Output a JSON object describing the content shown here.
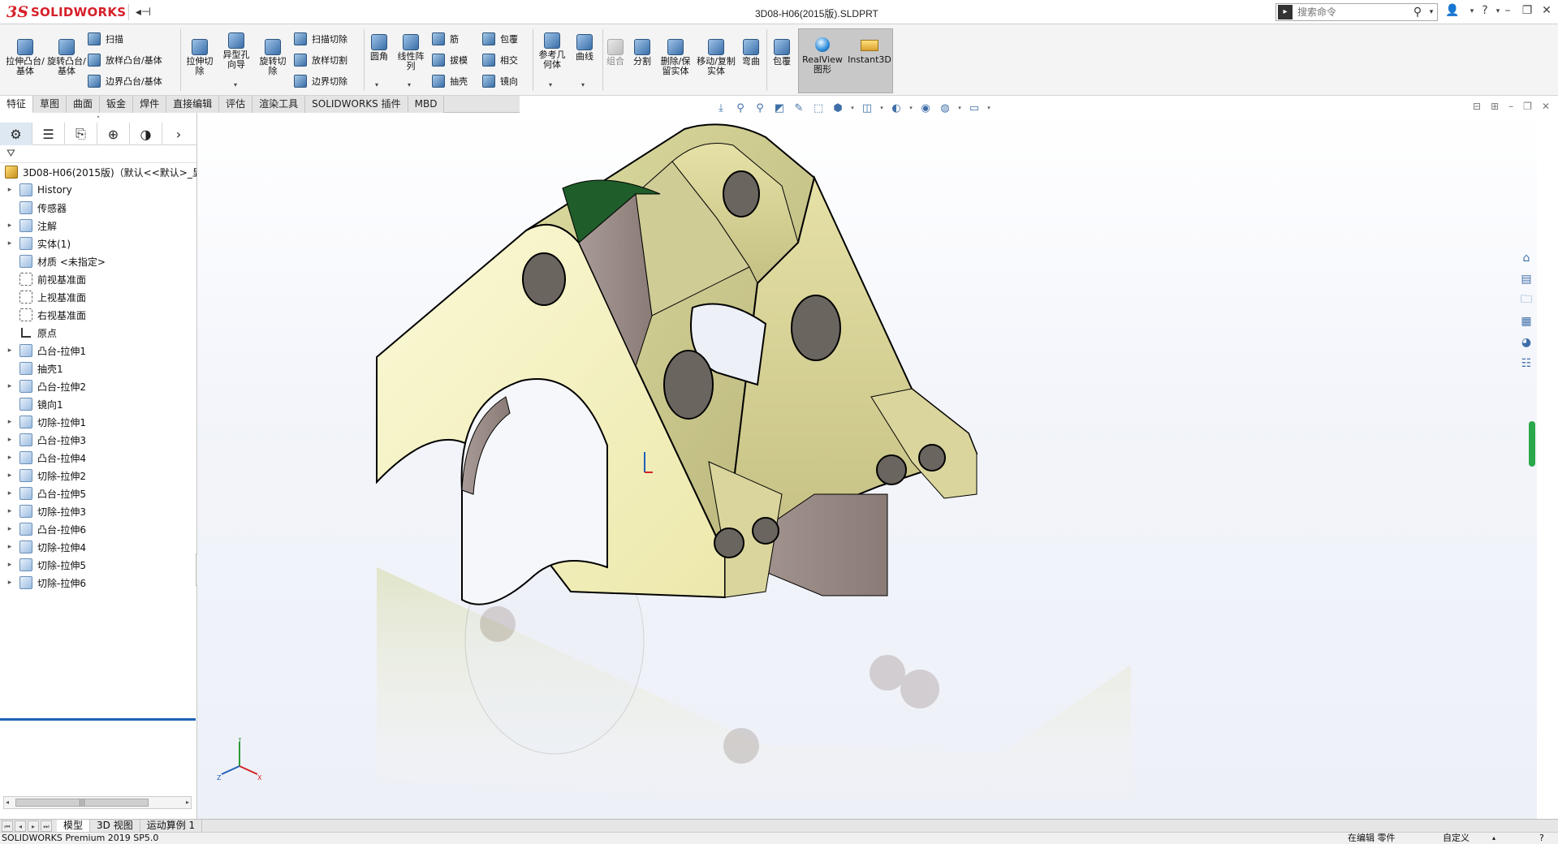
{
  "window": {
    "title": "3D08-H06(2015版).SLDPRT",
    "logo_ds": "3S",
    "logo_text": "SOLIDWORKS",
    "search": {
      "placeholder": "搜索命令"
    }
  },
  "ribbon": {
    "extrude_boss": "拉伸凸台/基体",
    "revolve_boss": "旋转凸台/基体",
    "sweep": "扫描",
    "loft_boss": "放样凸台/基体",
    "boundary_boss": "边界凸台/基体",
    "extrude_cut": "拉伸切除",
    "hole_wizard": "异型孔向导",
    "revolve_cut": "旋转切除",
    "swept_cut": "扫描切除",
    "lofted_cut": "放样切割",
    "boundary_cut": "边界切除",
    "fillet": "圆角",
    "linear_pattern": "线性阵列",
    "rib": "筋",
    "draft": "拔模",
    "shell": "抽壳",
    "wrap": "包覆",
    "intersect": "相交",
    "mirror": "镜向",
    "reference_geometry": "参考几何体",
    "curves": "曲线",
    "combine": "组合",
    "split": "分割",
    "delete_keep_body": "删除/保留实体",
    "move_copy_body": "移动/复制实体",
    "flex": "弯曲",
    "wrap2": "包覆",
    "realview": "RealView图形",
    "instant3d": "Instant3D"
  },
  "cm_tabs": [
    "特征",
    "草图",
    "曲面",
    "钣金",
    "焊件",
    "直接编辑",
    "评估",
    "渲染工具",
    "SOLIDWORKS 插件",
    "MBD"
  ],
  "tree": {
    "root": "3D08-H06(2015版)（默认<<默认>_显示",
    "items": [
      {
        "label": "History",
        "expandable": true,
        "icon": "history-icon"
      },
      {
        "label": "传感器",
        "expandable": false,
        "icon": "sensor-icon"
      },
      {
        "label": "注解",
        "expandable": true,
        "icon": "annotation-icon"
      },
      {
        "label": "实体(1)",
        "expandable": true,
        "icon": "solid-bodies-icon"
      },
      {
        "label": "材质 <未指定>",
        "expandable": false,
        "icon": "material-icon"
      },
      {
        "label": "前视基准面",
        "expandable": false,
        "icon": "plane-icon"
      },
      {
        "label": "上视基准面",
        "expandable": false,
        "icon": "plane-icon"
      },
      {
        "label": "右视基准面",
        "expandable": false,
        "icon": "plane-icon"
      },
      {
        "label": "原点",
        "expandable": false,
        "icon": "origin-icon"
      },
      {
        "label": "凸台-拉伸1",
        "expandable": true,
        "icon": "boss-extrude-icon"
      },
      {
        "label": "抽壳1",
        "expandable": false,
        "icon": "shell-icon"
      },
      {
        "label": "凸台-拉伸2",
        "expandable": true,
        "icon": "boss-extrude-icon"
      },
      {
        "label": "镜向1",
        "expandable": false,
        "icon": "mirror-icon"
      },
      {
        "label": "切除-拉伸1",
        "expandable": true,
        "icon": "cut-extrude-icon"
      },
      {
        "label": "凸台-拉伸3",
        "expandable": true,
        "icon": "boss-extrude-icon"
      },
      {
        "label": "凸台-拉伸4",
        "expandable": true,
        "icon": "boss-extrude-icon"
      },
      {
        "label": "切除-拉伸2",
        "expandable": true,
        "icon": "cut-extrude-icon"
      },
      {
        "label": "凸台-拉伸5",
        "expandable": true,
        "icon": "boss-extrude-icon"
      },
      {
        "label": "切除-拉伸3",
        "expandable": true,
        "icon": "cut-extrude-icon"
      },
      {
        "label": "凸台-拉伸6",
        "expandable": true,
        "icon": "boss-extrude-icon"
      },
      {
        "label": "切除-拉伸4",
        "expandable": true,
        "icon": "cut-extrude-icon"
      },
      {
        "label": "切除-拉伸5",
        "expandable": true,
        "icon": "cut-extrude-icon"
      },
      {
        "label": "切除-拉伸6",
        "expandable": true,
        "icon": "cut-extrude-icon"
      }
    ]
  },
  "bottom_tabs": [
    "模型",
    "3D 视图",
    "运动算例 1"
  ],
  "status": {
    "left": "SOLIDWORKS Premium 2019 SP5.0",
    "mode": "在编辑 零件",
    "custom": "自定义"
  },
  "colors": {
    "model_face": "#f2efb8",
    "model_edge": "#000000",
    "inner_face": "#9a8b86",
    "accent_blue": "#1d64b6"
  }
}
